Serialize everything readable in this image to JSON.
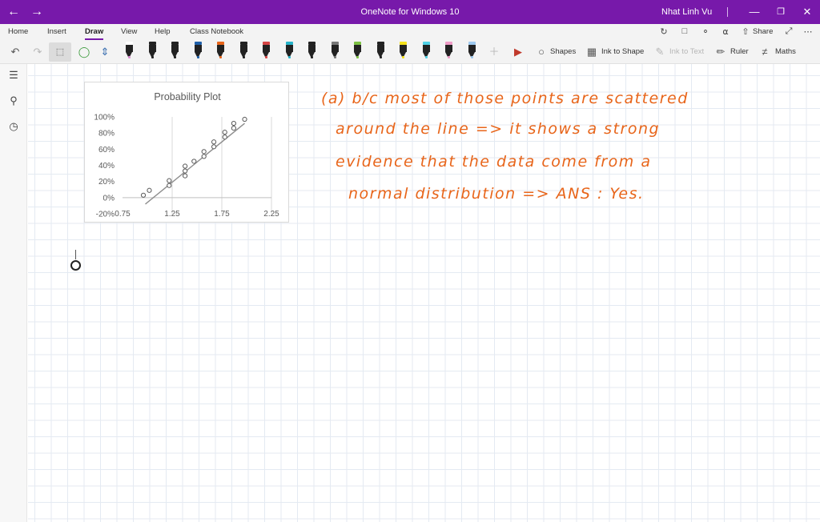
{
  "window": {
    "title": "OneNote for Windows 10",
    "user": "Nhat Linh Vu"
  },
  "ribbon": {
    "tabs": [
      "Home",
      "Insert",
      "Draw",
      "View",
      "Help",
      "Class Notebook"
    ],
    "active_tab": "Draw",
    "share_label": "Share"
  },
  "toolbar": {
    "pens": [
      {
        "cap": "#ffffff",
        "tip": "#d98bd1",
        "selected": true
      },
      {
        "cap": "#222222",
        "tip": "#222222"
      },
      {
        "cap": "#222222",
        "tip": "#222222"
      },
      {
        "cap": "#1f5fa8",
        "tip": "#1f5fa8"
      },
      {
        "cap": "#e8651a",
        "tip": "#e8651a"
      },
      {
        "cap": "#222222",
        "tip": "#222222"
      },
      {
        "cap": "#d64545",
        "tip": "#d64545"
      },
      {
        "cap": "#26b3c9",
        "tip": "#26b3c9"
      },
      {
        "cap": "#222222",
        "tip": "#222222"
      },
      {
        "cap": "#777777",
        "tip": "#777777"
      },
      {
        "cap": "#7cc142",
        "tip": "#7cc142"
      },
      {
        "cap": "#222222",
        "tip": "#222222"
      },
      {
        "cap": "#f5e11b",
        "tip": "#f5e11b"
      },
      {
        "cap": "#4fd1e6",
        "tip": "#4fd1e6"
      },
      {
        "cap": "#ef9bc7",
        "tip": "#ef9bc7"
      },
      {
        "cap": "#9ec9ef",
        "tip": "#9ec9ef"
      }
    ],
    "shapes_label": "Shapes",
    "ink_to_shape_label": "Ink to Shape",
    "ink_to_text_label": "Ink to Text",
    "ruler_label": "Ruler",
    "maths_label": "Maths"
  },
  "chart_data": {
    "type": "scatter",
    "title": "Probability Plot",
    "xlim": [
      0.75,
      2.25
    ],
    "ylim": [
      -20,
      100
    ],
    "x_ticks": [
      0.75,
      1.25,
      1.75,
      2.25
    ],
    "x_tick_labels": [
      "0.75",
      "1.25",
      "1.75",
      "2.25"
    ],
    "y_ticks": [
      -20,
      0,
      20,
      40,
      60,
      80,
      100
    ],
    "y_tick_labels": [
      "-20%",
      "0%",
      "20%",
      "40%",
      "60%",
      "80%",
      "100%"
    ],
    "grid": "vertical",
    "points": [
      {
        "x": 0.96,
        "y": 3
      },
      {
        "x": 1.02,
        "y": 9
      },
      {
        "x": 1.22,
        "y": 15
      },
      {
        "x": 1.22,
        "y": 21
      },
      {
        "x": 1.38,
        "y": 27
      },
      {
        "x": 1.38,
        "y": 33
      },
      {
        "x": 1.38,
        "y": 39
      },
      {
        "x": 1.47,
        "y": 45
      },
      {
        "x": 1.57,
        "y": 51
      },
      {
        "x": 1.57,
        "y": 57
      },
      {
        "x": 1.67,
        "y": 63
      },
      {
        "x": 1.67,
        "y": 69
      },
      {
        "x": 1.78,
        "y": 75
      },
      {
        "x": 1.78,
        "y": 81
      },
      {
        "x": 1.87,
        "y": 86
      },
      {
        "x": 1.87,
        "y": 92
      },
      {
        "x": 1.98,
        "y": 97
      }
    ],
    "fit_line": [
      {
        "x": 0.98,
        "y": -8
      },
      {
        "x": 1.98,
        "y": 92
      }
    ]
  },
  "notes": {
    "lines": [
      "(a) b/c most of those points are scattered",
      "around the line => it shows a strong",
      "evidence that the data come from a",
      "normal distribution => ANS : Yes."
    ]
  }
}
